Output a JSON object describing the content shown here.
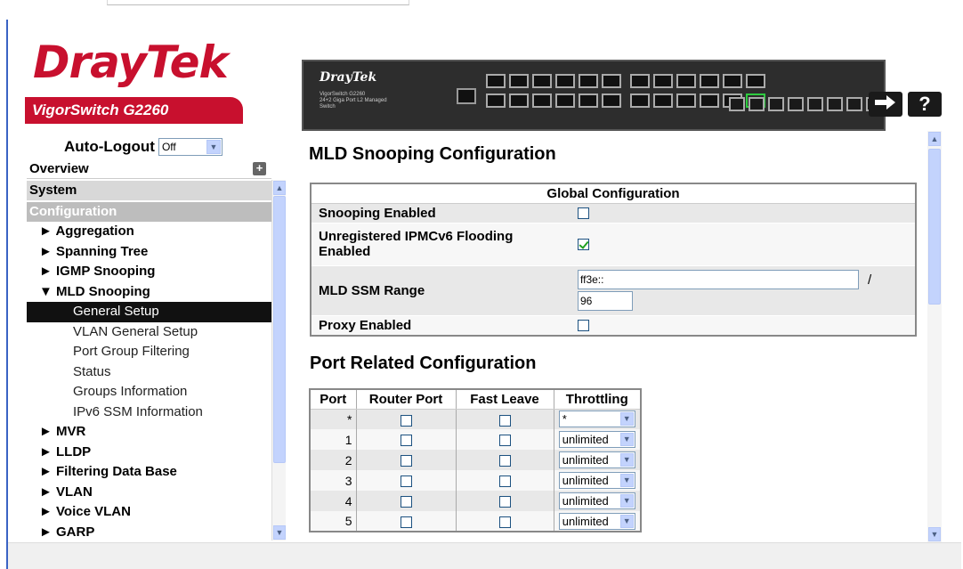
{
  "header": {
    "brand_logo": "DrayTek",
    "model_name": "VigorSwitch G2260",
    "device_brand": "DrayTek",
    "device_model": "VigorSwitch G2260",
    "device_desc": "24+2 Giga Port L2 Managed Switch",
    "logout_icon": "logout-arrow-icon",
    "help_label": "?"
  },
  "sidebar": {
    "auto_logout_label": "Auto-Logout",
    "auto_logout_value": "Off",
    "overview": "Overview",
    "system": "System",
    "configuration": "Configuration",
    "sections": [
      {
        "label": "► Aggregation"
      },
      {
        "label": "► Spanning Tree"
      },
      {
        "label": "► IGMP Snooping"
      },
      {
        "label": "▼ MLD Snooping"
      }
    ],
    "mld_items": [
      "General Setup",
      "VLAN General Setup",
      "Port Group Filtering",
      "Status",
      "Groups Information",
      "IPv6 SSM Information"
    ],
    "more_sections": [
      "► MVR",
      "► LLDP",
      "► Filtering Data Base",
      "► VLAN",
      "► Voice VLAN",
      "► GARP"
    ]
  },
  "main": {
    "title": "MLD Snooping Configuration",
    "global": {
      "header": "Global Configuration",
      "snooping_enabled_label": "Snooping Enabled",
      "unregistered_label": "Unregistered IPMCv6 Flooding Enabled",
      "ssm_range_label": "MLD SSM Range",
      "ssm_range_value": "ff3e::",
      "ssm_separator": "/",
      "ssm_prefix_value": "96",
      "proxy_label": "Proxy Enabled"
    },
    "port_title": "Port Related Configuration",
    "port_table": {
      "headers": [
        "Port",
        "Router Port",
        "Fast Leave",
        "Throttling"
      ],
      "rows": [
        {
          "port": "*",
          "throttling": "*"
        },
        {
          "port": "1",
          "throttling": "unlimited"
        },
        {
          "port": "2",
          "throttling": "unlimited"
        },
        {
          "port": "3",
          "throttling": "unlimited"
        },
        {
          "port": "4",
          "throttling": "unlimited"
        },
        {
          "port": "5",
          "throttling": "unlimited"
        }
      ]
    }
  },
  "colors": {
    "brand_red": "#c8102e",
    "scroll_blue": "#c3d3fd"
  }
}
